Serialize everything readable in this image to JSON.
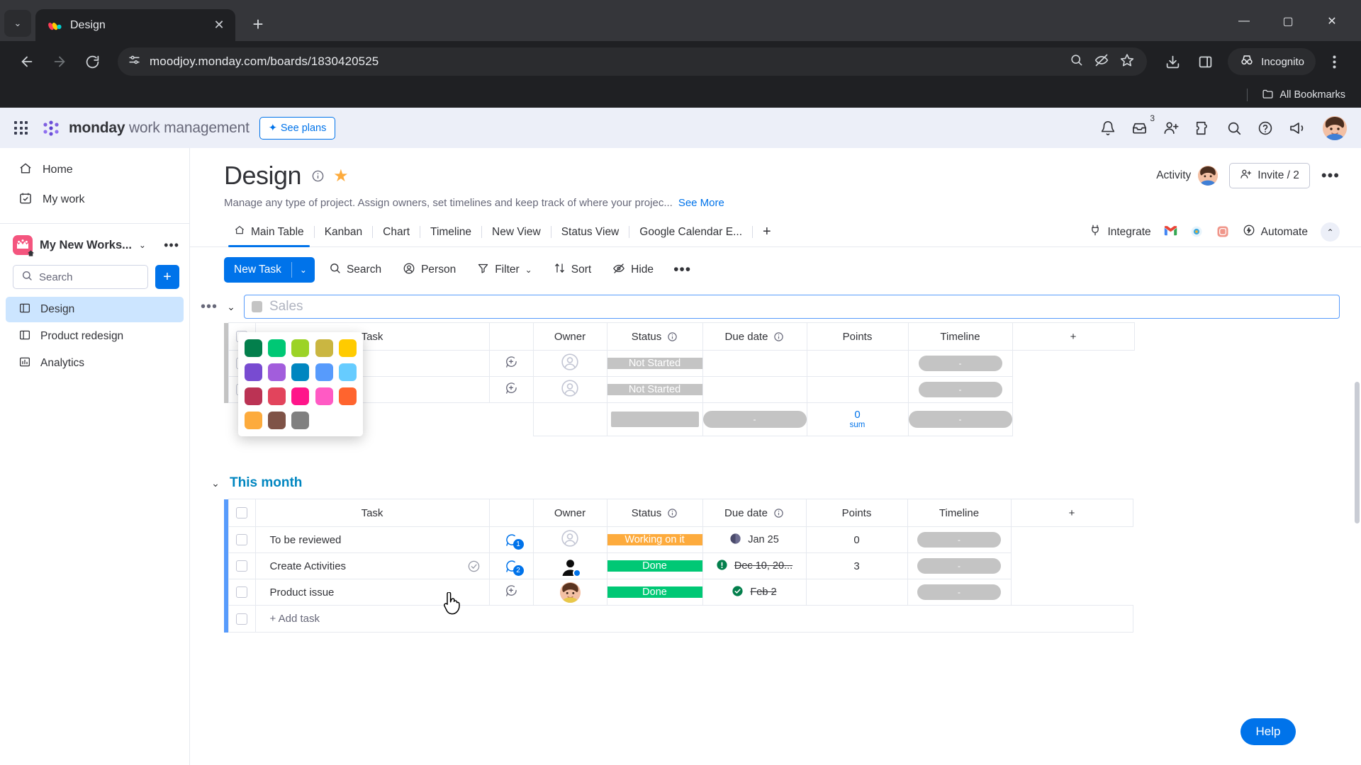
{
  "browser": {
    "tab": {
      "title": "Design",
      "favicon": "monday-logo-icon",
      "close": "✕"
    },
    "new_tab": "+",
    "tab_list_chevron": "⌄",
    "window": {
      "minimize": "—",
      "maximize": "▢",
      "close": "✕"
    },
    "nav": {
      "back": "←",
      "forward": "→",
      "reload": "⟳"
    },
    "url": "moodjoy.monday.com/boards/1830420525",
    "omnibox_icons": [
      "page-settings-icon",
      "zoom-icon",
      "tracking-protection-icon",
      "bookmark-star-icon"
    ],
    "download_icon": "download-icon",
    "sidepanel_icon": "side-panel-icon",
    "incognito_label": "Incognito",
    "bookmarks_label": "All Bookmarks"
  },
  "topbar": {
    "waffle": "apps-grid-icon",
    "brand_bold": "monday",
    "brand_light": " work management",
    "see_plans": "See plans",
    "icons": [
      {
        "name": "notifications-bell-icon",
        "badge": ""
      },
      {
        "name": "inbox-icon",
        "badge": "3"
      },
      {
        "name": "invite-member-icon",
        "badge": ""
      },
      {
        "name": "apps-extensions-icon",
        "badge": ""
      },
      {
        "name": "search-icon",
        "badge": ""
      },
      {
        "name": "help-icon",
        "badge": ""
      },
      {
        "name": "whats-new-icon",
        "badge": ""
      }
    ]
  },
  "sidebar": {
    "home": "Home",
    "my_work": "My work",
    "workspace": {
      "name": "My New Works...",
      "chevron": "⌄",
      "dots": "•••"
    },
    "search_placeholder": "Search",
    "add_button": "+",
    "boards": [
      {
        "label": "Design",
        "icon": "board-icon",
        "active": true
      },
      {
        "label": "Product redesign",
        "icon": "board-icon",
        "active": false
      },
      {
        "label": "Analytics",
        "icon": "dashboard-icon",
        "active": false
      }
    ]
  },
  "board": {
    "title": "Design",
    "info_icon": "info-icon",
    "star_icon": "star-icon",
    "description": "Manage any type of project. Assign owners, set timelines and keep track of where your projec...",
    "see_more": "See More",
    "activity_label": "Activity",
    "invite_label": "Invite / 2",
    "more_label": "•••"
  },
  "view_tabs": [
    {
      "label": "Main Table",
      "icon": "home-icon",
      "active": true
    },
    {
      "label": "Kanban",
      "active": false
    },
    {
      "label": "Chart",
      "active": false
    },
    {
      "label": "Timeline",
      "active": false
    },
    {
      "label": "New View",
      "active": false
    },
    {
      "label": "Status View",
      "active": false
    },
    {
      "label": "Google Calendar E...",
      "active": false
    }
  ],
  "view_tabs_add": "+",
  "tabs_right": {
    "integrate": "Integrate",
    "automate": "Automate",
    "integration_icons": [
      "gmail-icon",
      "slack-icon",
      "instagram-icon"
    ],
    "collapse": "⌃"
  },
  "toolbar": {
    "new_task": "New Task",
    "new_task_chevron": "⌄",
    "search": "Search",
    "person": "Person",
    "filter": "Filter",
    "filter_chevron": "⌄",
    "sort": "Sort",
    "hide": "Hide",
    "more": "•••"
  },
  "columns": {
    "task": "Task",
    "owner": "Owner",
    "status": "Status",
    "due_date": "Due date",
    "points": "Points",
    "timeline": "Timeline",
    "add": "+"
  },
  "group_editing": {
    "dots": "•••",
    "chevron": "⌄",
    "name_value": "Sales",
    "swatch_color": "#c4c4c4"
  },
  "color_picker": {
    "colors": [
      "#037f4c",
      "#00c875",
      "#9cd326",
      "#cab641",
      "#ffcb00",
      "#784bd1",
      "#a25ddc",
      "#0086c0",
      "#579bfc",
      "#66ccff",
      "#bb3354",
      "#e2445c",
      "#ff158a",
      "#ff5ac4",
      "#ff642e",
      "#fdab3d",
      "#7f5347",
      "#808080"
    ]
  },
  "group_editing_rows": [
    {
      "task": "",
      "owner": "",
      "status": "Not Started",
      "status_color": "#c4c4c4",
      "due_date": "",
      "points": "",
      "timeline": "-"
    },
    {
      "task": "",
      "owner": "",
      "status": "Not Started",
      "status_color": "#c4c4c4",
      "due_date": "",
      "points": "",
      "timeline": "-"
    }
  ],
  "group_editing_summary": {
    "points": "0",
    "points_label": "sum",
    "timeline": "-"
  },
  "group_this_month": {
    "chevron": "⌄",
    "title": "This month",
    "title_color": "#0086c0",
    "rows": [
      {
        "task": "To be reviewed",
        "has_check": false,
        "conversation": "1",
        "conversation_type": "comment",
        "owner": "empty-avatar",
        "status": "Working on it",
        "status_color": "#fdab3d",
        "due_date": "Jan 25",
        "date_state": "pending",
        "date_strike": false,
        "points": "0",
        "timeline": "-"
      },
      {
        "task": "Create Activities",
        "has_check": true,
        "conversation": "2",
        "conversation_type": "comment",
        "owner": "dark-avatar",
        "status": "Done",
        "status_color": "#00c875",
        "due_date": "Dec 10, 20...",
        "date_state": "overdue",
        "date_strike": true,
        "points": "3",
        "timeline": "-"
      },
      {
        "task": "Product issue",
        "has_check": false,
        "conversation": "",
        "conversation_type": "add",
        "owner": "photo-avatar",
        "status": "Done",
        "status_color": "#00c875",
        "due_date": "Feb 2",
        "date_state": "done",
        "date_strike": true,
        "points": "",
        "timeline": "-"
      }
    ],
    "add_task": "+ Add task"
  },
  "help_button": "Help"
}
